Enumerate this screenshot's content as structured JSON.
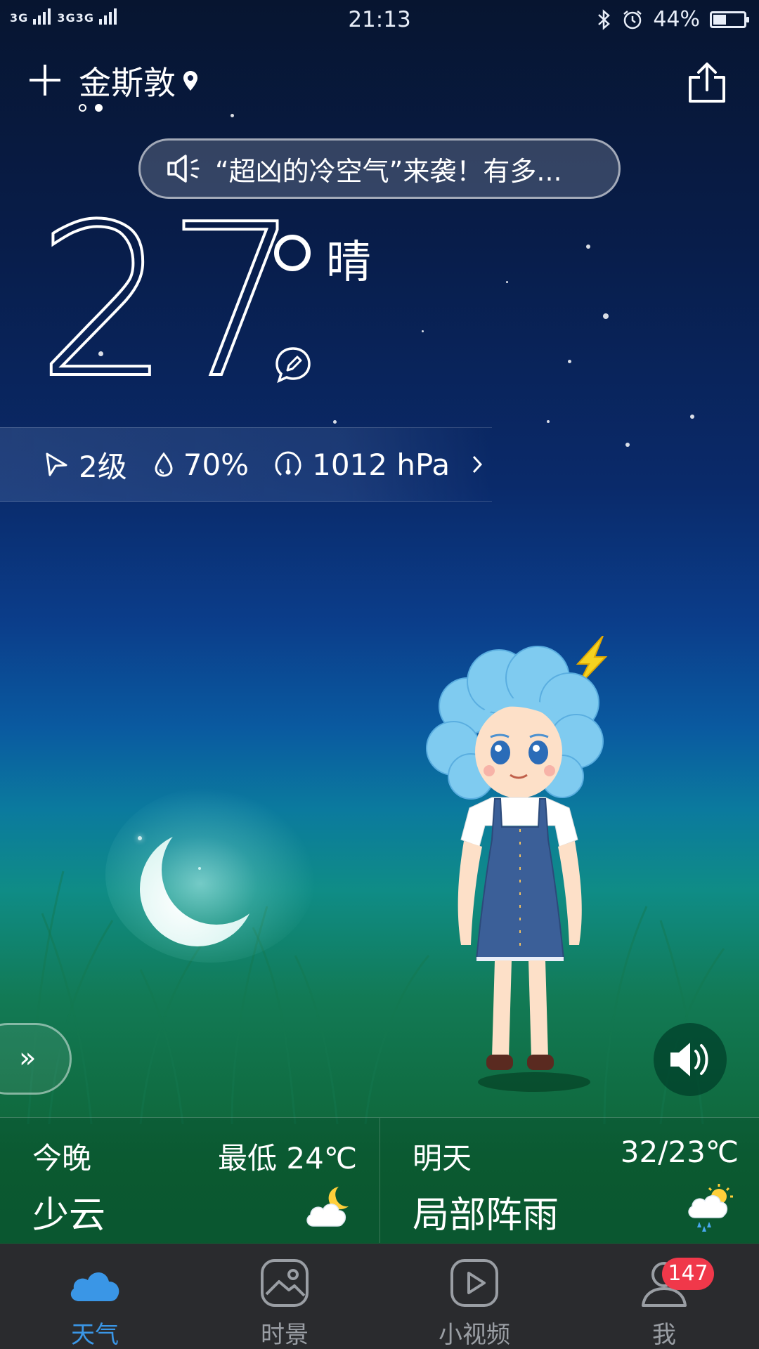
{
  "status_bar": {
    "network_1": "3G",
    "network_2": "3G",
    "network_3": "3G",
    "time": "21:13",
    "battery": "44%",
    "battery_fraction": 0.44
  },
  "header": {
    "city": "金斯敦",
    "page_dots_total": 2,
    "page_dots_active": 2
  },
  "news": {
    "text": "“超凶的冷空气”来袭！有多..."
  },
  "current": {
    "temperature": "27",
    "condition": "晴"
  },
  "details": {
    "wind": "2级",
    "humidity": "70%",
    "pressure": "1012 hPa"
  },
  "forecast": {
    "tonight": {
      "label": "今晚",
      "range": "最低 24℃",
      "desc": "少云",
      "icon": "cloud-moon-icon"
    },
    "tomorrow": {
      "label": "明天",
      "range": "32/23℃",
      "desc": "局部阵雨",
      "icon": "cloud-sun-rain-icon"
    }
  },
  "nav": {
    "tabs": [
      {
        "label": "天气",
        "icon": "cloud-icon",
        "active": true
      },
      {
        "label": "时景",
        "icon": "image-icon",
        "active": false
      },
      {
        "label": "小视频",
        "icon": "play-icon",
        "active": false
      },
      {
        "label": "我",
        "icon": "profile-icon",
        "active": false
      }
    ],
    "badge": "147"
  },
  "colors": {
    "accent": "#3a96e6",
    "badge": "#f0384a",
    "nav_bg": "#2a2b2e"
  }
}
